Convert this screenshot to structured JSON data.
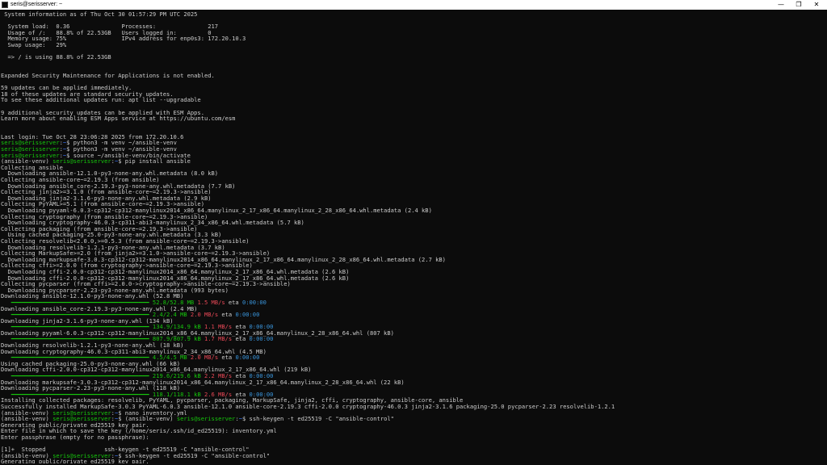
{
  "window": {
    "title": "seris@serisserver: ~",
    "buttons": {
      "minimize": "—",
      "maximize": "❐",
      "close": "✕"
    }
  },
  "colors": {
    "background": "#0c0c0c",
    "text": "#cccccc",
    "prompt_green": "#16c60c",
    "path_blue": "#3b78ff",
    "speed_red": "#e74856",
    "eta_cyan": "#3a96dd"
  },
  "lines": [
    [
      {
        "t": " System information as of Thu Oct 30 01:57:29 PM UTC 2025"
      }
    ],
    [
      {
        "t": ""
      }
    ],
    [
      {
        "t": "  System load:  0.36               Processes:               217"
      }
    ],
    [
      {
        "t": "  Usage of /:   88.8% of 22.53GB   Users logged in:         0"
      }
    ],
    [
      {
        "t": "  Memory usage: 75%                IPv4 address for enp0s3: 172.20.10.3"
      }
    ],
    [
      {
        "t": "  Swap usage:   29%"
      }
    ],
    [
      {
        "t": ""
      }
    ],
    [
      {
        "t": "  => / is using 88.8% of 22.53GB"
      }
    ],
    [
      {
        "t": ""
      }
    ],
    [
      {
        "t": ""
      }
    ],
    [
      {
        "t": "Expanded Security Maintenance for Applications is not enabled."
      }
    ],
    [
      {
        "t": ""
      }
    ],
    [
      {
        "t": "59 updates can be applied immediately."
      }
    ],
    [
      {
        "t": "18 of these updates are standard security updates."
      }
    ],
    [
      {
        "t": "To see these additional updates run: apt list --upgradable"
      }
    ],
    [
      {
        "t": ""
      }
    ],
    [
      {
        "t": "9 additional security updates can be applied with ESM Apps."
      }
    ],
    [
      {
        "t": "Learn more about enabling ESM Apps service at https://ubuntu.com/esm"
      }
    ],
    [
      {
        "t": ""
      }
    ],
    [
      {
        "t": ""
      }
    ],
    [
      {
        "t": "Last login: Tue Oct 28 23:06:28 2025 from 172.20.10.6"
      }
    ],
    [
      {
        "t": "seris@serisserver",
        "c": "g"
      },
      {
        "t": ":"
      },
      {
        "t": "~",
        "c": "b"
      },
      {
        "t": "$ python3 -m venv ~/ansible-venv"
      }
    ],
    [
      {
        "t": "seris@serisserver",
        "c": "g"
      },
      {
        "t": ":"
      },
      {
        "t": "~",
        "c": "b"
      },
      {
        "t": "$ python3 -m venv ~/ansible-venv"
      }
    ],
    [
      {
        "t": "seris@serisserver",
        "c": "g"
      },
      {
        "t": ":"
      },
      {
        "t": "~",
        "c": "b"
      },
      {
        "t": "$ source ~/ansible-venv/bin/activate"
      }
    ],
    [
      {
        "t": "(ansible-venv) "
      },
      {
        "t": "seris@serisserver",
        "c": "g"
      },
      {
        "t": ":"
      },
      {
        "t": "~",
        "c": "b"
      },
      {
        "t": "$ pip install ansible"
      }
    ],
    [
      {
        "t": "Collecting ansible"
      }
    ],
    [
      {
        "t": "  Downloading ansible-12.1.0-py3-none-any.whl.metadata (8.0 kB)"
      }
    ],
    [
      {
        "t": "Collecting ansible-core~=2.19.3 (from ansible)"
      }
    ],
    [
      {
        "t": "  Downloading ansible_core-2.19.3-py3-none-any.whl.metadata (7.7 kB)"
      }
    ],
    [
      {
        "t": "Collecting jinja2>=3.1.0 (from ansible-core~=2.19.3->ansible)"
      }
    ],
    [
      {
        "t": "  Downloading jinja2-3.1.6-py3-none-any.whl.metadata (2.9 kB)"
      }
    ],
    [
      {
        "t": "Collecting PyYAML>=5.1 (from ansible-core~=2.19.3->ansible)"
      }
    ],
    [
      {
        "t": "  Downloading pyyaml-6.0.3-cp312-cp312-manylinux2014_x86_64.manylinux_2_17_x86_64.manylinux_2_28_x86_64.whl.metadata (2.4 kB)"
      }
    ],
    [
      {
        "t": "Collecting cryptography (from ansible-core~=2.19.3->ansible)"
      }
    ],
    [
      {
        "t": "  Downloading cryptography-46.0.3-cp311-abi3-manylinux_2_34_x86_64.whl.metadata (5.7 kB)"
      }
    ],
    [
      {
        "t": "Collecting packaging (from ansible-core~=2.19.3->ansible)"
      }
    ],
    [
      {
        "t": "  Using cached packaging-25.0-py3-none-any.whl.metadata (3.3 kB)"
      }
    ],
    [
      {
        "t": "Collecting resolvelib<2.0.0,>=0.5.3 (from ansible-core~=2.19.3->ansible)"
      }
    ],
    [
      {
        "t": "  Downloading resolvelib-1.2.1-py3-none-any.whl.metadata (3.7 kB)"
      }
    ],
    [
      {
        "t": "Collecting MarkupSafe>=2.0 (from jinja2>=3.1.0->ansible-core~=2.19.3->ansible)"
      }
    ],
    [
      {
        "t": "  Downloading markupsafe-3.0.3-cp312-cp312-manylinux2014_x86_64.manylinux_2_17_x86_64.manylinux_2_28_x86_64.whl.metadata (2.7 kB)"
      }
    ],
    [
      {
        "t": "Collecting cffi>=2.0.0 (from cryptography->ansible-core~=2.19.3->ansible)"
      }
    ],
    [
      {
        "t": "  Downloading cffi-2.0.0-cp312-cp312-manylinux2014_x86_64.manylinux_2_17_x86_64.whl.metadata (2.6 kB)"
      }
    ],
    [
      {
        "t": "  Downloading cffi-2.0.0-cp312-cp312-manylinux2014_x86_64.manylinux_2_17_x86_64.whl.metadata (2.6 kB)"
      }
    ],
    [
      {
        "t": "Collecting pycparser (from cffi>=2.0.0->cryptography->ansible-core~=2.19.3->ansible)"
      }
    ],
    [
      {
        "t": "  Downloading pycparser-2.23-py3-none-any.whl.metadata (993 bytes)"
      }
    ],
    [
      {
        "t": "Downloading ansible-12.1.0-py3-none-any.whl (52.8 MB)"
      }
    ],
    [
      {
        "t": "   ━━━━━━━━━━━━━━━━━━━━━━━━━━━━━━━━━━━━━━━━ ",
        "c": "bar"
      },
      {
        "t": "52.8/52.8 MB",
        "c": "g"
      },
      {
        "t": " "
      },
      {
        "t": "1.5 MB/s",
        "c": "r"
      },
      {
        "t": " eta "
      },
      {
        "t": "0:00:00",
        "c": "c"
      }
    ],
    [
      {
        "t": "Downloading ansible_core-2.19.3-py3-none-any.whl (2.4 MB)"
      }
    ],
    [
      {
        "t": "   ━━━━━━━━━━━━━━━━━━━━━━━━━━━━━━━━━━━━━━━━ ",
        "c": "bar"
      },
      {
        "t": "2.4/2.4 MB",
        "c": "g"
      },
      {
        "t": " "
      },
      {
        "t": "2.0 MB/s",
        "c": "r"
      },
      {
        "t": " eta "
      },
      {
        "t": "0:00:00",
        "c": "c"
      }
    ],
    [
      {
        "t": "Downloading jinja2-3.1.6-py3-none-any.whl (134 kB)"
      }
    ],
    [
      {
        "t": "   ━━━━━━━━━━━━━━━━━━━━━━━━━━━━━━━━━━━━━━━━ ",
        "c": "bar"
      },
      {
        "t": "134.9/134.9 kB",
        "c": "g"
      },
      {
        "t": " "
      },
      {
        "t": "1.1 MB/s",
        "c": "r"
      },
      {
        "t": " eta "
      },
      {
        "t": "0:00:00",
        "c": "c"
      }
    ],
    [
      {
        "t": "Downloading pyyaml-6.0.3-cp312-cp312-manylinux2014_x86_64.manylinux_2_17_x86_64.manylinux_2_28_x86_64.whl (807 kB)"
      }
    ],
    [
      {
        "t": "   ━━━━━━━━━━━━━━━━━━━━━━━━━━━━━━━━━━━━━━━━ ",
        "c": "bar"
      },
      {
        "t": "807.9/807.9 kB",
        "c": "g"
      },
      {
        "t": " "
      },
      {
        "t": "1.7 MB/s",
        "c": "r"
      },
      {
        "t": " eta "
      },
      {
        "t": "0:00:00",
        "c": "c"
      }
    ],
    [
      {
        "t": "Downloading resolvelib-1.2.1-py3-none-any.whl (18 kB)"
      }
    ],
    [
      {
        "t": "Downloading cryptography-46.0.3-cp311-abi3-manylinux_2_34_x86_64.whl (4.5 MB)"
      }
    ],
    [
      {
        "t": "   ━━━━━━━━━━━━━━━━━━━━━━━━━━━━━━━━━━━━━━━━ ",
        "c": "bar"
      },
      {
        "t": "4.5/4.5 MB",
        "c": "g"
      },
      {
        "t": " "
      },
      {
        "t": "2.0 MB/s",
        "c": "r"
      },
      {
        "t": " eta "
      },
      {
        "t": "0:00:00",
        "c": "c"
      }
    ],
    [
      {
        "t": "Using cached packaging-25.0-py3-none-any.whl (66 kB)"
      }
    ],
    [
      {
        "t": "Downloading cffi-2.0.0-cp312-cp312-manylinux2014_x86_64.manylinux_2_17_x86_64.whl (219 kB)"
      }
    ],
    [
      {
        "t": "   ━━━━━━━━━━━━━━━━━━━━━━━━━━━━━━━━━━━━━━━━ ",
        "c": "bar"
      },
      {
        "t": "219.6/219.6 kB",
        "c": "g"
      },
      {
        "t": " "
      },
      {
        "t": "2.2 MB/s",
        "c": "r"
      },
      {
        "t": " eta "
      },
      {
        "t": "0:00:00",
        "c": "c"
      }
    ],
    [
      {
        "t": "Downloading markupsafe-3.0.3-cp312-cp312-manylinux2014_x86_64.manylinux_2_17_x86_64.manylinux_2_28_x86_64.whl (22 kB)"
      }
    ],
    [
      {
        "t": "Downloading pycparser-2.23-py3-none-any.whl (118 kB)"
      }
    ],
    [
      {
        "t": "   ━━━━━━━━━━━━━━━━━━━━━━━━━━━━━━━━━━━━━━━━ ",
        "c": "bar"
      },
      {
        "t": "118.1/118.1 kB",
        "c": "g"
      },
      {
        "t": " "
      },
      {
        "t": "2.6 MB/s",
        "c": "r"
      },
      {
        "t": " eta "
      },
      {
        "t": "0:00:00",
        "c": "c"
      }
    ],
    [
      {
        "t": "Installing collected packages: resolvelib, PyYAML, pycparser, packaging, MarkupSafe, jinja2, cffi, cryptography, ansible-core, ansible"
      }
    ],
    [
      {
        "t": "Successfully installed MarkupSafe-3.0.3 PyYAML-6.0.3 ansible-12.1.0 ansible-core-2.19.3 cffi-2.0.0 cryptography-46.0.3 jinja2-3.1.6 packaging-25.0 pycparser-2.23 resolvelib-1.2.1"
      }
    ],
    [
      {
        "t": "(ansible-venv) "
      },
      {
        "t": "seris@serisserver",
        "c": "g"
      },
      {
        "t": ":"
      },
      {
        "t": "~",
        "c": "b"
      },
      {
        "t": "$ nano inventory.yml"
      }
    ],
    [
      {
        "t": "(ansible-venv) "
      },
      {
        "t": "seris@serisserver",
        "c": "g"
      },
      {
        "t": ":"
      },
      {
        "t": "~",
        "c": "b"
      },
      {
        "t": "$ (ansible-venv) "
      },
      {
        "t": "seris@serisserver",
        "c": "g"
      },
      {
        "t": ":"
      },
      {
        "t": "~",
        "c": "b"
      },
      {
        "t": "$ ssh-keygen -t ed25519 -C \"ansible-control\""
      }
    ],
    [
      {
        "t": "Generating public/private ed25519 key pair."
      }
    ],
    [
      {
        "t": "Enter file in which to save the key (/home/seris/.ssh/id_ed25519): inventory.yml"
      }
    ],
    [
      {
        "t": "Enter passphrase (empty for no passphrase):"
      }
    ],
    [
      {
        "t": ""
      }
    ],
    [
      {
        "t": "[1]+  Stopped                 ssh-keygen -t ed25519 -C \"ansible-control\""
      }
    ],
    [
      {
        "t": "(ansible-venv) "
      },
      {
        "t": "seris@serisserver",
        "c": "g"
      },
      {
        "t": ":"
      },
      {
        "t": "~",
        "c": "b"
      },
      {
        "t": "$ ssh-keygen -t ed25519 -C \"ansible-control\""
      }
    ],
    [
      {
        "t": "Generating public/private ed25519 key pair."
      }
    ]
  ]
}
